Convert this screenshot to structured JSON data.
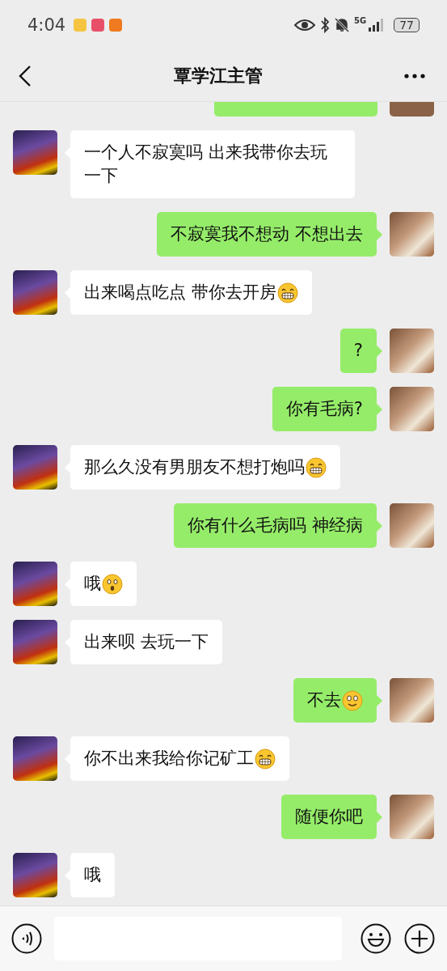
{
  "status_bar": {
    "time": "4:04",
    "network": "5G",
    "battery": "77"
  },
  "header": {
    "title": "覃学江主管"
  },
  "clipped_message": {
    "outgoing": true
  },
  "messages": [
    {
      "outgoing": false,
      "text": "一个人不寂寞吗 出来我带你去玩一下"
    },
    {
      "outgoing": true,
      "text": "不寂寞我不想动 不想出去"
    },
    {
      "outgoing": false,
      "text": "出来喝点吃点 带你去开房",
      "emoji": {
        "kind": "grin"
      }
    },
    {
      "outgoing": true,
      "text": "?"
    },
    {
      "outgoing": true,
      "text": "你有毛病?"
    },
    {
      "outgoing": false,
      "text": "那么久没有男朋友不想打炮吗",
      "emoji": {
        "kind": "grin"
      }
    },
    {
      "outgoing": true,
      "text": "你有什么毛病吗 神经病"
    },
    {
      "outgoing": false,
      "text": "哦",
      "emoji": {
        "kind": "astonished"
      }
    },
    {
      "outgoing": false,
      "text": "出来呗 去玩一下"
    },
    {
      "outgoing": true,
      "text": "不去",
      "emoji": {
        "kind": "smile"
      }
    },
    {
      "outgoing": false,
      "text": "你不出来我给你记矿工",
      "emoji": {
        "kind": "grin"
      }
    },
    {
      "outgoing": true,
      "text": "随便你吧"
    },
    {
      "outgoing": false,
      "text": "哦"
    }
  ]
}
